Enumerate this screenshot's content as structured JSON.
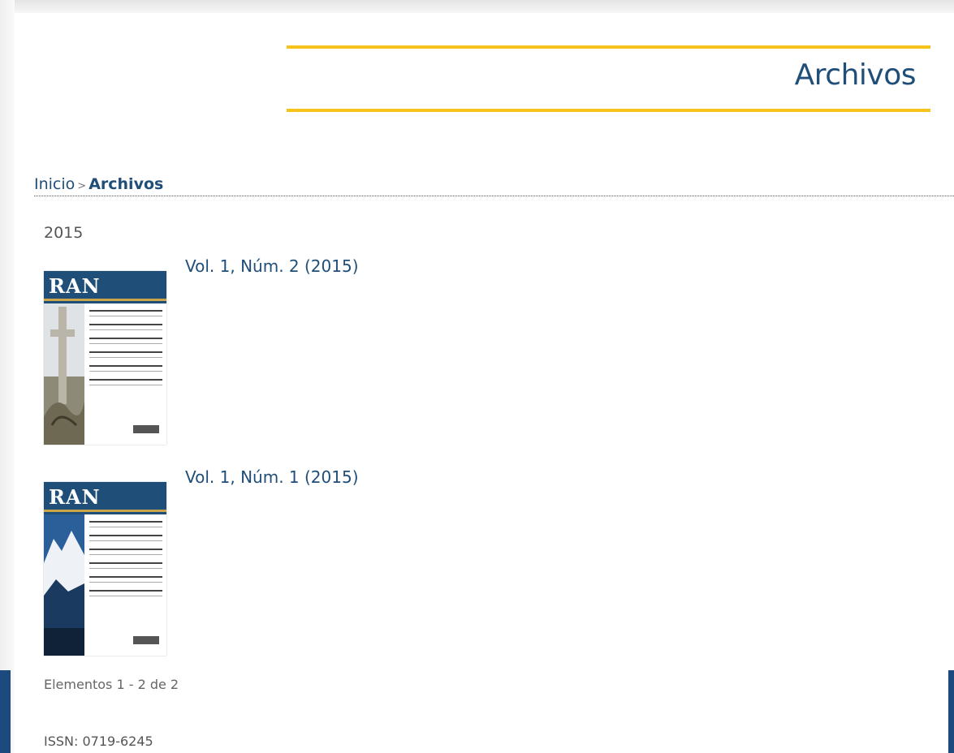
{
  "page": {
    "title": "Archivos"
  },
  "breadcrumb": {
    "home": "Inicio",
    "separator": ">",
    "current": "Archivos"
  },
  "archive": {
    "year": "2015",
    "issues": [
      {
        "title": "Vol. 1, Núm. 2 (2015)",
        "cover_title": "RAN"
      },
      {
        "title": "Vol. 1, Núm. 1 (2015)",
        "cover_title": "RAN"
      }
    ]
  },
  "pagination": {
    "summary": "Elementos 1 - 2 de 2"
  },
  "footer": {
    "issn": "ISSN: 0719-6245"
  },
  "colors": {
    "accent": "#f5c31c",
    "brand": "#1f4e79",
    "footer": "#1d4a7e"
  }
}
